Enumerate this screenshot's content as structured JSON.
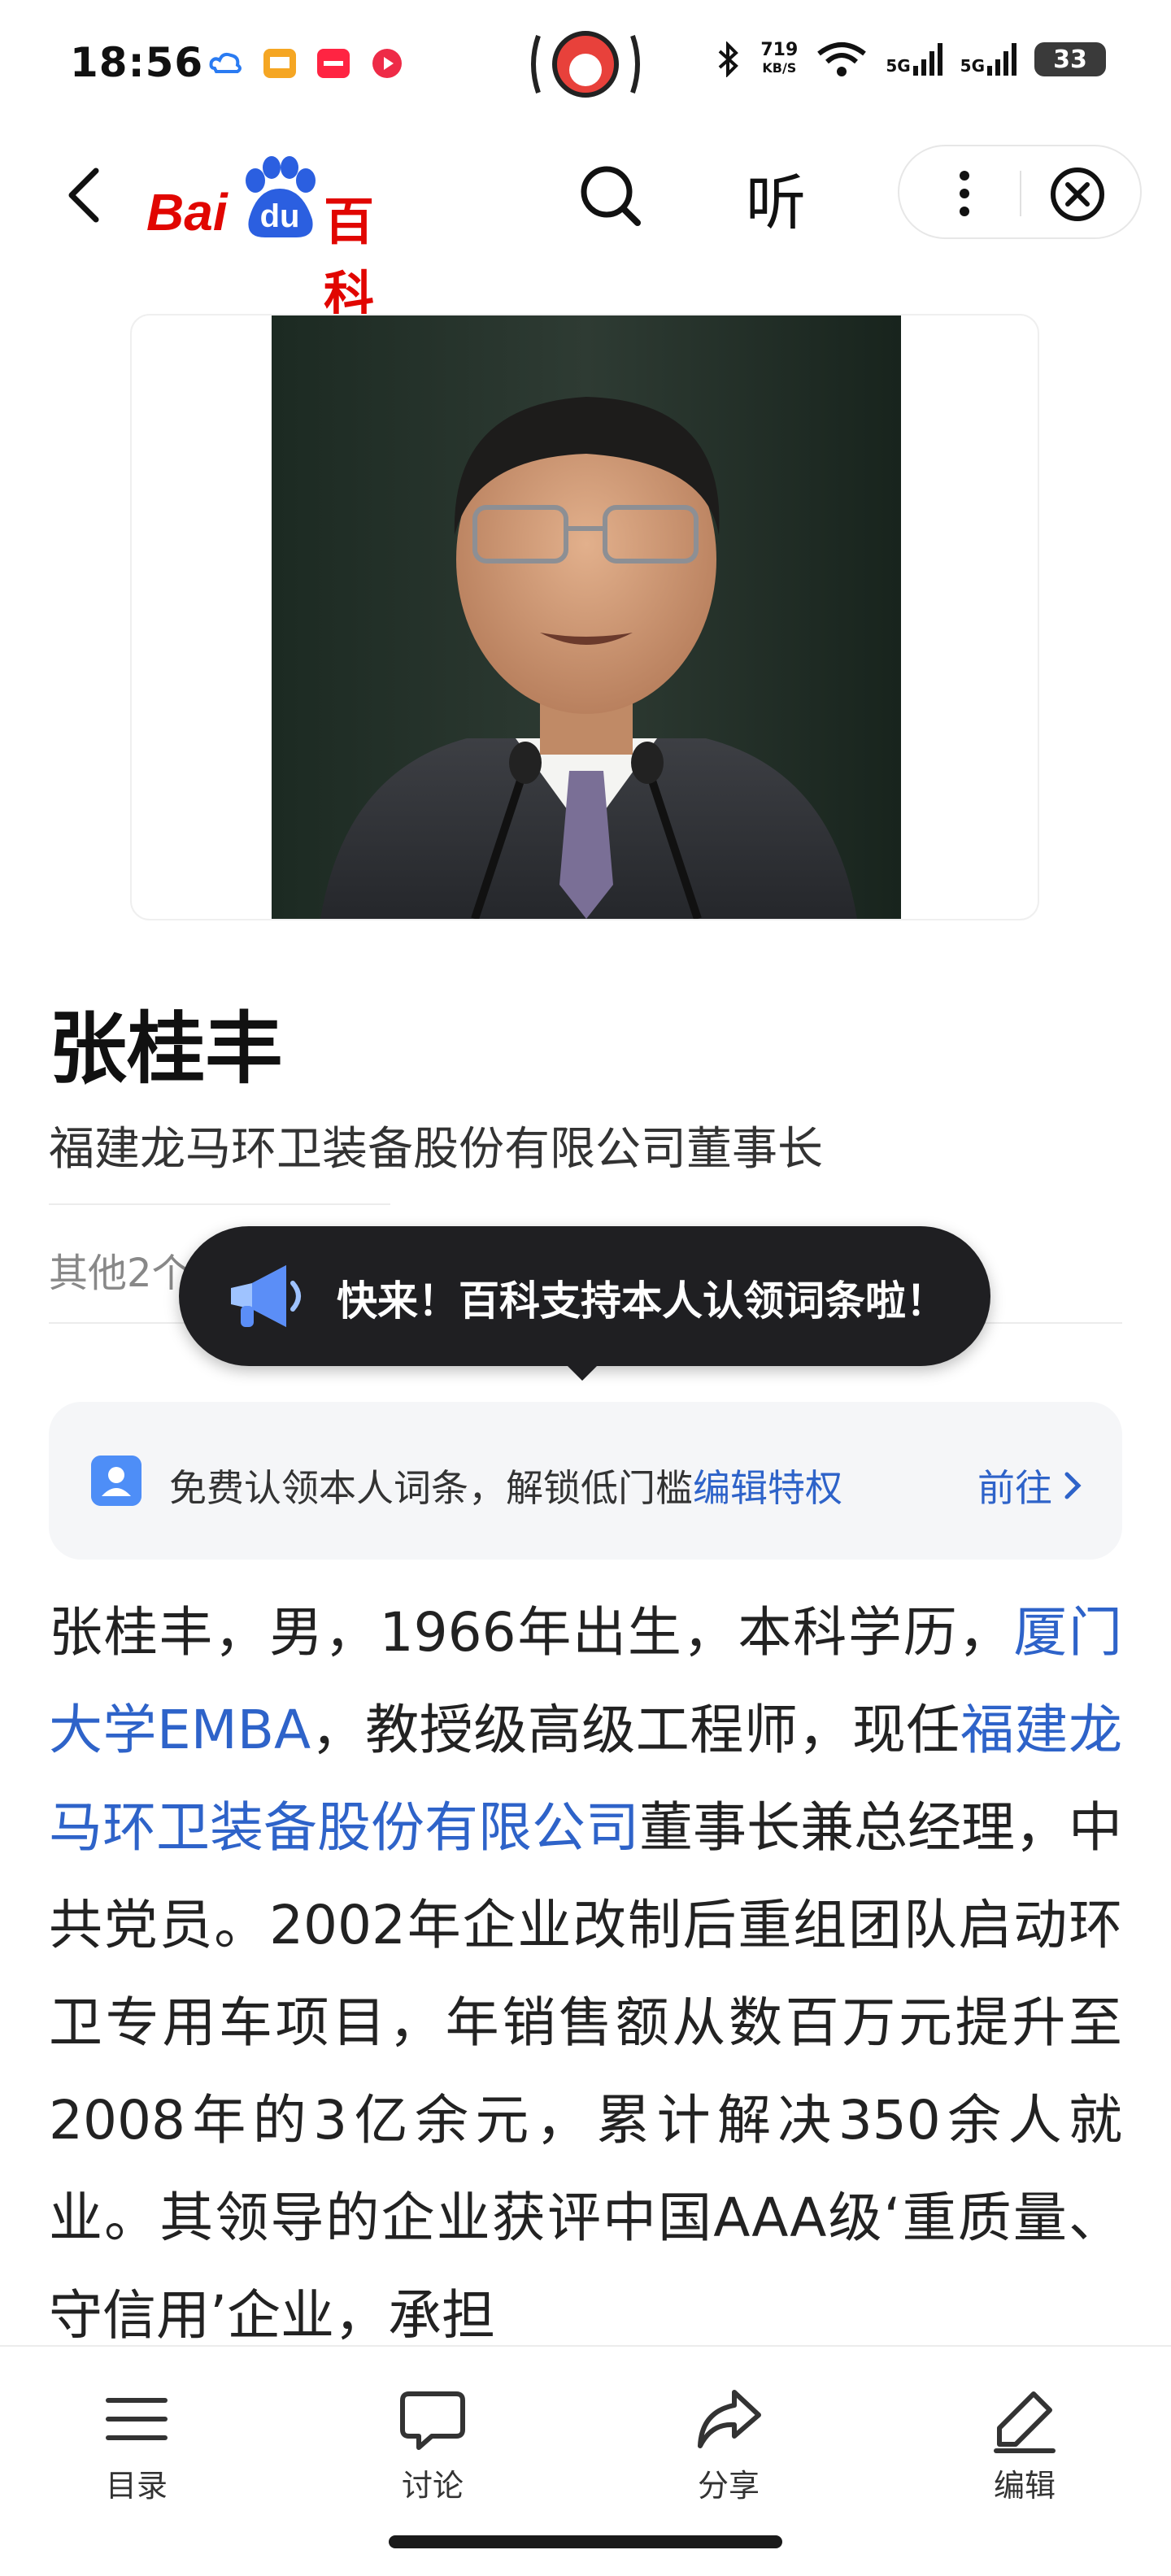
{
  "status_bar": {
    "time": "18:56",
    "net_speed_value": "719",
    "net_speed_unit": "KB/S",
    "signal_1": "5G",
    "signal_2": "5G",
    "battery": "33"
  },
  "nav": {
    "logo_prefix": "Bai",
    "logo_du": "du",
    "logo_suffix": "百科",
    "listen_label": "听"
  },
  "entry": {
    "title": "张桂丰",
    "subtitle": "福建龙马环卫装备股份有限公司董事长",
    "other_meanings": "其他2个同名词条 >"
  },
  "tooltip": {
    "text": "快来！百科支持本人认领词条啦！"
  },
  "claim_banner": {
    "text": "免费认领本人词条，解锁低门槛",
    "link": "编辑特权",
    "go_label": "前往"
  },
  "article": {
    "p1": "张桂丰，男，1966年出生，本科学历，",
    "link1": "厦门大学EMBA",
    "p2": "，教授级高级工程师，现任",
    "link2": "福建龙马环卫装备股份有限公司",
    "p3": "董事长兼总经理，中共党员。2002年企业改制后重组团队启动环卫专用车项目，年销售额从数百万元提升至2008年的3亿余元，累计解决350余人就业。其领导的企业获评中国AAA级‘重质量、守信用’企业，承担"
  },
  "toolbar": {
    "catalog_label": "目录",
    "discuss_label": "讨论",
    "share_label": "分享",
    "edit_label": "编辑"
  },
  "colors": {
    "brand_red": "#e10601",
    "brand_blue": "#2b5fe0",
    "link_blue": "#2e63c9",
    "tooltip_bg": "#1f1f22"
  }
}
